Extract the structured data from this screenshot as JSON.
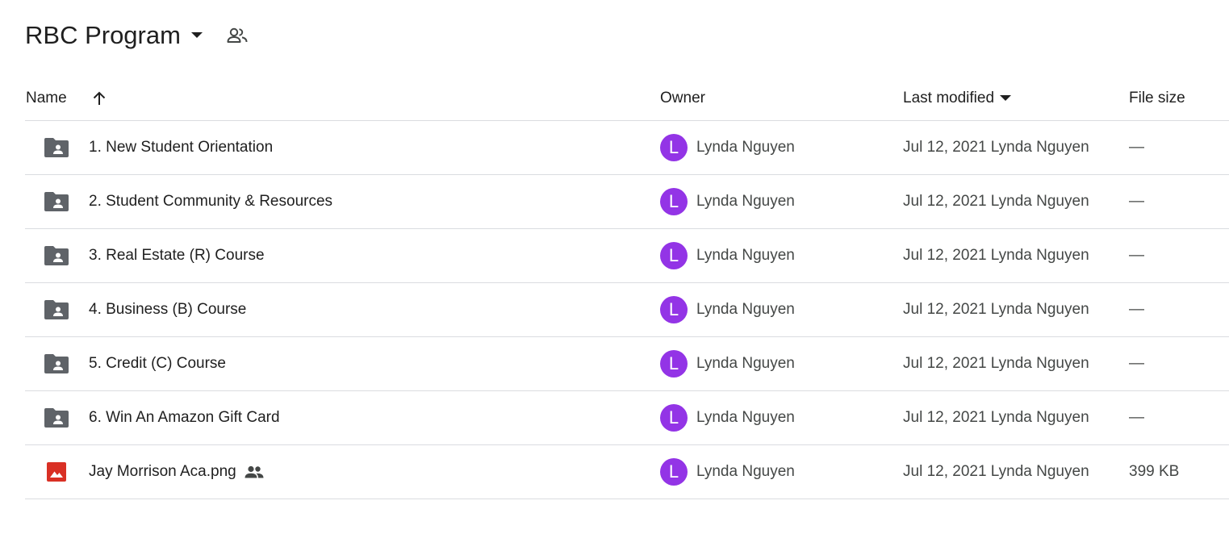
{
  "folder": {
    "title": "RBC Program",
    "dropdown_icon": "caret-down-icon",
    "shared_icon": "people-outline-icon"
  },
  "columns": {
    "name": "Name",
    "name_sort_icon": "arrow-up-icon",
    "owner": "Owner",
    "last_modified": "Last modified",
    "last_modified_sort_icon": "caret-down-icon",
    "file_size": "File size"
  },
  "colors": {
    "folder_icon": "#5f6368",
    "image_icon": "#d93025",
    "avatar_bg": "#9334e6",
    "divider": "#dadce0"
  },
  "rows": [
    {
      "type": "folder",
      "icon": "shared-folder-icon",
      "name": "1. New Student Orientation",
      "shared": false,
      "owner_initial": "L",
      "owner": "Lynda Nguyen",
      "modified": "Jul 12, 2021 Lynda Nguyen",
      "size": "—"
    },
    {
      "type": "folder",
      "icon": "shared-folder-icon",
      "name": "2. Student Community & Resources",
      "shared": false,
      "owner_initial": "L",
      "owner": "Lynda Nguyen",
      "modified": "Jul 12, 2021 Lynda Nguyen",
      "size": "—"
    },
    {
      "type": "folder",
      "icon": "shared-folder-icon",
      "name": "3. Real Estate (R) Course",
      "shared": false,
      "owner_initial": "L",
      "owner": "Lynda Nguyen",
      "modified": "Jul 12, 2021 Lynda Nguyen",
      "size": "—"
    },
    {
      "type": "folder",
      "icon": "shared-folder-icon",
      "name": "4. Business (B) Course",
      "shared": false,
      "owner_initial": "L",
      "owner": "Lynda Nguyen",
      "modified": "Jul 12, 2021 Lynda Nguyen",
      "size": "—"
    },
    {
      "type": "folder",
      "icon": "shared-folder-icon",
      "name": "5. Credit (C) Course",
      "shared": false,
      "owner_initial": "L",
      "owner": "Lynda Nguyen",
      "modified": "Jul 12, 2021 Lynda Nguyen",
      "size": "—"
    },
    {
      "type": "folder",
      "icon": "shared-folder-icon",
      "name": "6. Win An Amazon Gift Card",
      "shared": false,
      "owner_initial": "L",
      "owner": "Lynda Nguyen",
      "modified": "Jul 12, 2021 Lynda Nguyen",
      "size": "—"
    },
    {
      "type": "image",
      "icon": "image-file-icon",
      "name": "Jay Morrison Aca.png",
      "shared": true,
      "owner_initial": "L",
      "owner": "Lynda Nguyen",
      "modified": "Jul 12, 2021 Lynda Nguyen",
      "size": "399 KB"
    }
  ]
}
